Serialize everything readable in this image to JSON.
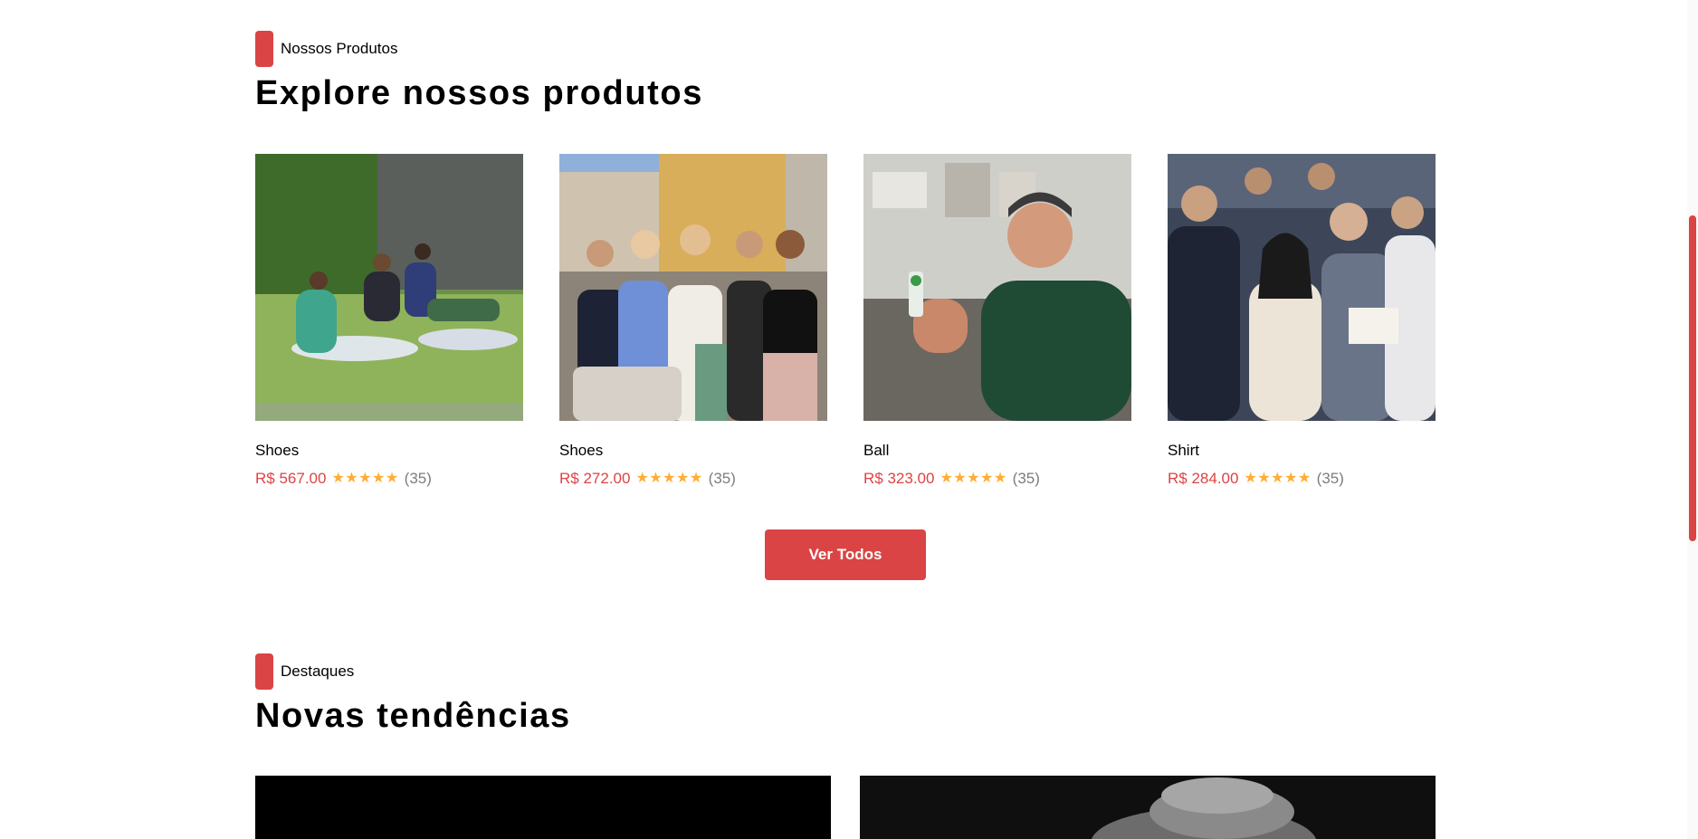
{
  "colors": {
    "accent": "#db4444",
    "star": "#ffad33",
    "muted": "#7d7d7d"
  },
  "section1": {
    "tag": "Nossos Produtos",
    "title": "Explore nossos produtos"
  },
  "products": [
    {
      "name": "Shoes",
      "price": "R$ 567.00",
      "rating": 5,
      "reviews": "(35)",
      "image": "outdoor-picnic-photo"
    },
    {
      "name": "Shoes",
      "price": "R$ 272.00",
      "rating": 5,
      "reviews": "(35)",
      "image": "group-photo"
    },
    {
      "name": "Ball",
      "price": "R$ 323.00",
      "rating": 5,
      "reviews": "(35)",
      "image": "man-in-workshop-photo"
    },
    {
      "name": "Shirt",
      "price": "R$ 284.00",
      "rating": 5,
      "reviews": "(35)",
      "image": "conference-audience-photo"
    }
  ],
  "view_all_label": "Ver Todos",
  "section2": {
    "tag": "Destaques",
    "title": "Novas tendências"
  }
}
